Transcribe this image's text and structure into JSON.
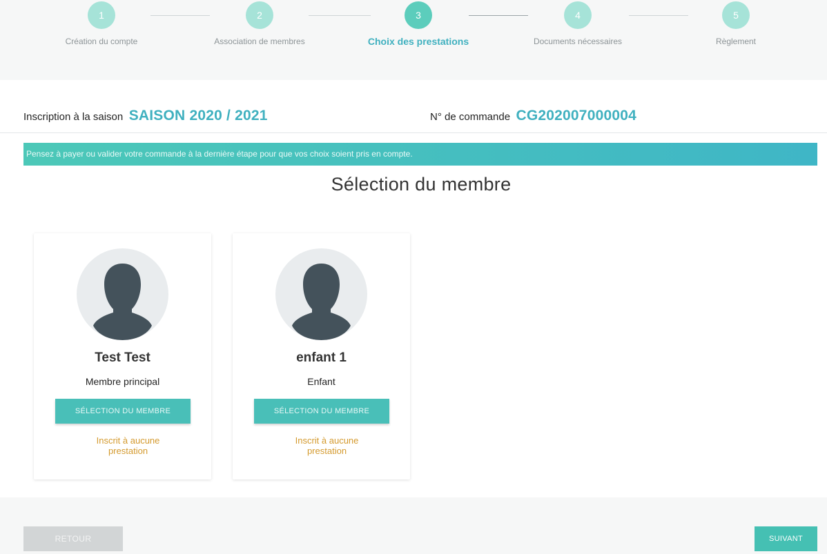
{
  "stepper": {
    "steps": [
      {
        "number": "1",
        "label": "Création du compte"
      },
      {
        "number": "2",
        "label": "Association de membres"
      },
      {
        "number": "3",
        "label": "Choix des prestations"
      },
      {
        "number": "4",
        "label": "Documents nécessaires"
      },
      {
        "number": "5",
        "label": "Règlement"
      }
    ],
    "active_index": 2
  },
  "header": {
    "season_prefix": "Inscription à la saison",
    "season_value": "SAISON 2020 / 2021",
    "order_prefix": "N° de commande",
    "order_value": "CG202007000004"
  },
  "banner": {
    "text": "Pensez à payer ou valider votre commande à la dernière étape pour que vos choix soient pris en compte."
  },
  "main": {
    "title": "Sélection du membre"
  },
  "members": [
    {
      "name": "Test Test",
      "role": "Membre principal",
      "button_label": "SÉLECTION DU MEMBRE",
      "status": "Inscrit à aucune prestation",
      "avatar_icon": "user-silhouette-icon"
    },
    {
      "name": "enfant 1",
      "role": "Enfant",
      "button_label": "SÉLECTION DU MEMBRE",
      "status": "Inscrit à aucune prestation",
      "avatar_icon": "user-silhouette-icon"
    }
  ],
  "footer": {
    "back_label": "RETOUR",
    "next_label": "SUIVANT"
  },
  "colors": {
    "accent": "#3fb0bf",
    "button": "#49bfb8",
    "status": "#d49a2e"
  }
}
